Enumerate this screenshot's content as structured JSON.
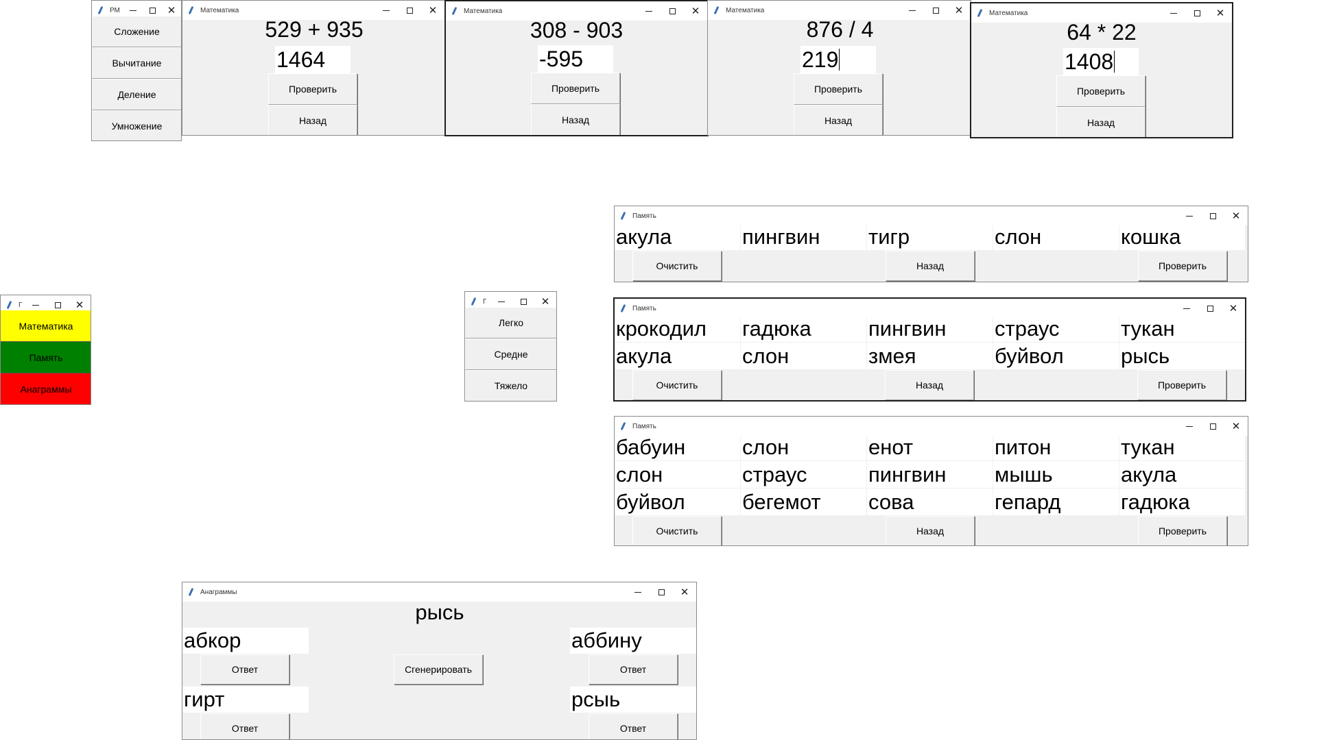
{
  "colors": {
    "yellow": "#ffff00",
    "green": "#008000",
    "red": "#ff0000"
  },
  "ops_window": {
    "title_short": "РМ",
    "items": [
      "Сложение",
      "Вычитание",
      "Деление",
      "Умножение"
    ]
  },
  "math_windows": [
    {
      "title": "Математика",
      "problem": "529 + 935",
      "answer": "1464",
      "check": "Проверить",
      "back": "Назад"
    },
    {
      "title": "Математика",
      "problem": "308 - 903",
      "answer": "-595",
      "check": "Проверить",
      "back": "Назад"
    },
    {
      "title": "Математика",
      "problem": "876 / 4",
      "answer": "219",
      "check": "Проверить",
      "back": "Назад"
    },
    {
      "title": "Математика",
      "problem": "64 * 22",
      "answer": "1408",
      "check": "Проверить",
      "back": "Назад"
    }
  ],
  "main_menu": {
    "title": "Г",
    "math": "Математика",
    "memory": "Память",
    "anagrams": "Анаграммы"
  },
  "difficulty": {
    "title": "Г",
    "easy": "Легко",
    "medium": "Средне",
    "hard": "Тяжело"
  },
  "memory_windows": [
    {
      "title": "Память",
      "rows": [
        [
          "акула",
          "пингвин",
          "тигр",
          "слон",
          "кошка"
        ]
      ],
      "clear": "Очистить",
      "back": "Назад",
      "check": "Проверить"
    },
    {
      "title": "Память",
      "rows": [
        [
          "крокодил",
          "гадюка",
          "пингвин",
          "страус",
          "тукан"
        ],
        [
          "акула",
          "слон",
          "змея",
          "буйвол",
          "рысь"
        ]
      ],
      "clear": "Очистить",
      "back": "Назад",
      "check": "Проверить"
    },
    {
      "title": "Память",
      "rows": [
        [
          "бабуин",
          "слон",
          "енот",
          "питон",
          "тукан"
        ],
        [
          "слон",
          "страус",
          "пингвин",
          "мышь",
          "акула"
        ],
        [
          "буйвол",
          "бегемот",
          "сова",
          "гепард",
          "гадюка"
        ]
      ],
      "clear": "Очистить",
      "back": "Назад",
      "check": "Проверить"
    }
  ],
  "anagram_window": {
    "title": "Анаграммы",
    "word": "рысь",
    "generate": "Сгенерировать",
    "answer_label": "Ответ",
    "anagrams": [
      "абкор",
      "аббину",
      "гирт",
      "рсыь"
    ]
  }
}
